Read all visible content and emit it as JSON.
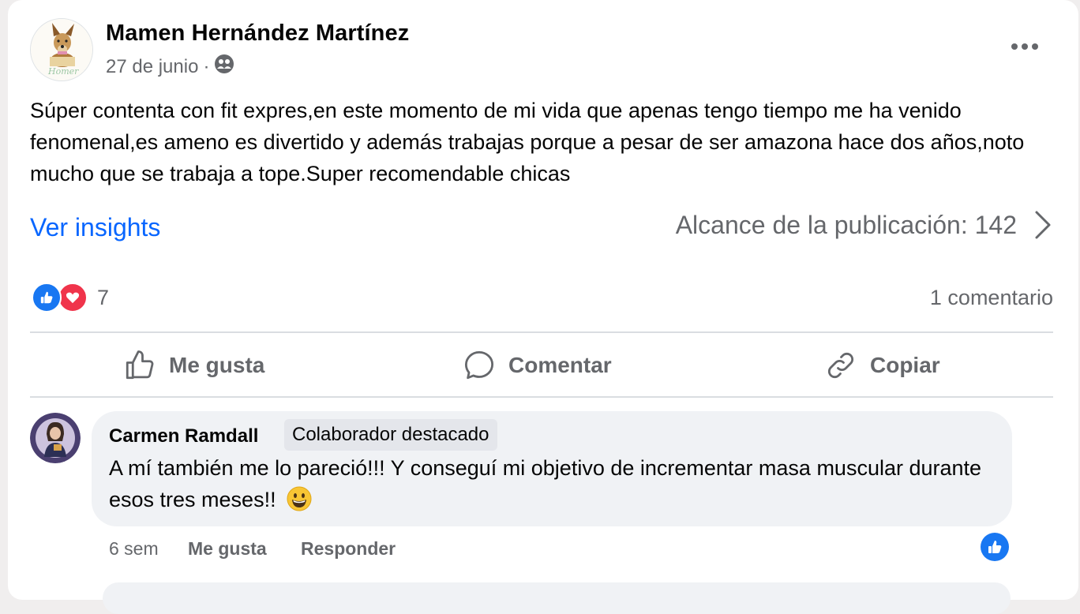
{
  "post": {
    "author": "Mamen Hernández Martínez",
    "date": "27 de junio",
    "separator": "·",
    "privacy_icon": "friends-icon",
    "text": "Súper contenta con fit expres,en este momento de mi vida que apenas tengo tiempo me ha venido fenomenal,es ameno es divertido y además trabajas porque a pesar de ser amazona hace dos años,noto mucho que se trabaja a tope.Super recomendable chicas",
    "insights_label": "Ver insights",
    "reach_label": "Alcance de la publicación: 142",
    "reaction_count": "7",
    "comment_count": "1 comentario",
    "avatar_caption": "Homer"
  },
  "actions": {
    "like": "Me gusta",
    "comment": "Comentar",
    "copy": "Copiar"
  },
  "comment": {
    "author": "Carmen Ramdall",
    "badge": "Colaborador destacado",
    "text": "A mí también me lo pareció!!! Y conseguí mi objetivo de incrementar masa muscular durante esos tres meses!!",
    "time": "6 sem",
    "like": "Me gusta",
    "reply": "Responder"
  },
  "colors": {
    "accent": "#0866ff",
    "like_blue": "#1877f2",
    "love_red": "#f0344b",
    "secondary_text": "#65676b",
    "bubble_bg": "#f0f2f5"
  }
}
